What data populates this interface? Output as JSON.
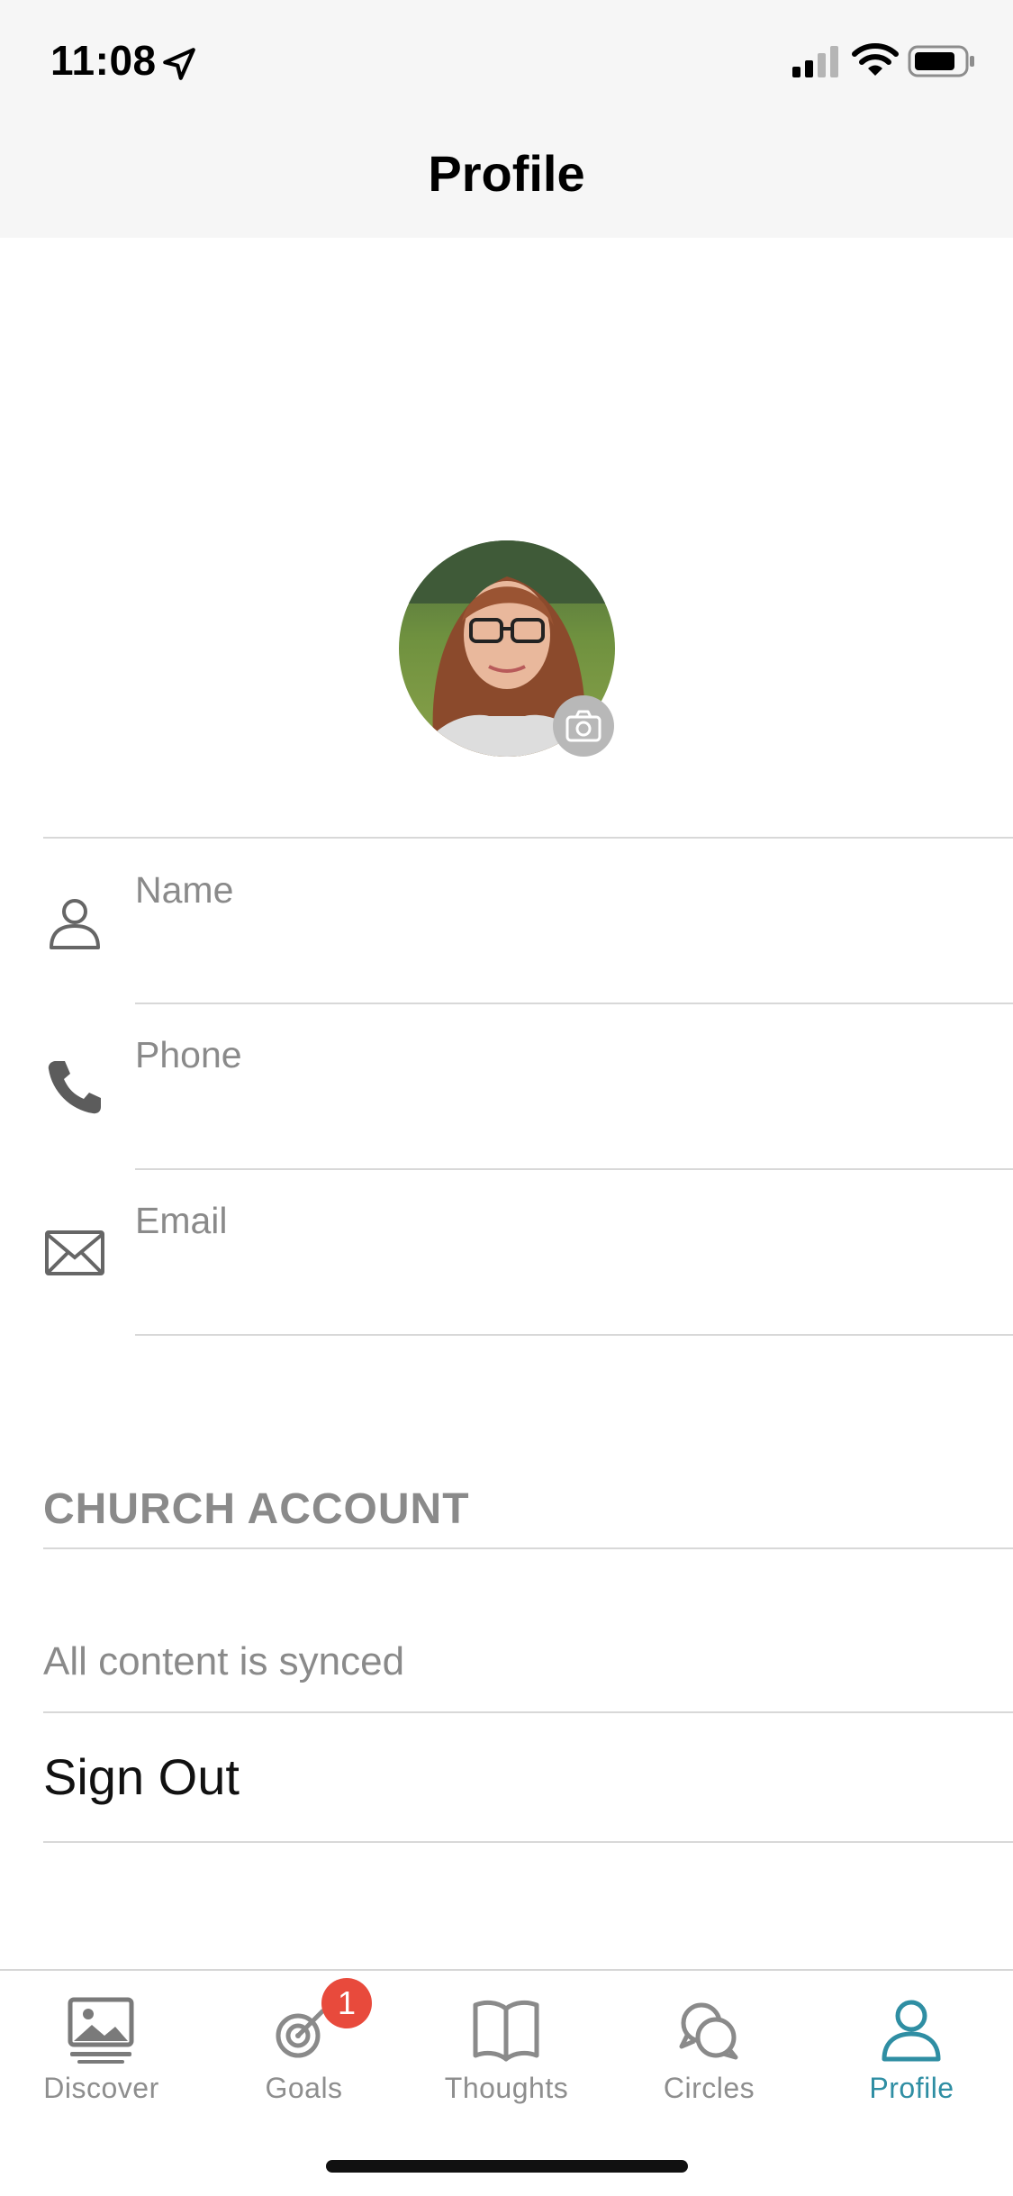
{
  "status_bar": {
    "time": "11:08"
  },
  "nav": {
    "title": "Profile"
  },
  "profile": {
    "fields": [
      {
        "placeholder": "Name",
        "value": ""
      },
      {
        "placeholder": "Phone",
        "value": ""
      },
      {
        "placeholder": "Email",
        "value": ""
      }
    ]
  },
  "account": {
    "section_header": "CHURCH ACCOUNT",
    "sync_status": "All content is synced",
    "sign_out_label": "Sign Out"
  },
  "tabbar": {
    "tabs": [
      {
        "label": "Discover"
      },
      {
        "label": "Goals",
        "badge": "1"
      },
      {
        "label": "Thoughts"
      },
      {
        "label": "Circles"
      },
      {
        "label": "Profile"
      }
    ],
    "active": "Profile"
  },
  "colors": {
    "accent": "#2f8ea3",
    "badge": "#e84a3c",
    "muted_text": "#8a8a8a"
  },
  "icons": [
    "location-arrow-icon",
    "signal-icon",
    "wifi-icon",
    "battery-icon",
    "camera-icon",
    "person-icon",
    "phone-icon",
    "envelope-icon",
    "image-icon",
    "target-icon",
    "book-icon",
    "chat-bubbles-icon",
    "profile-icon"
  ]
}
